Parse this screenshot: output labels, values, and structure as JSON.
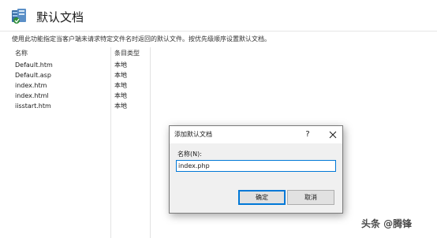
{
  "header": {
    "title": "默认文档",
    "icon": "iis-server-icon"
  },
  "description": "使用此功能指定当客户端未请求特定文件名时返回的默认文件。按优先级顺序设置默认文档。",
  "list": {
    "columns": [
      "名称",
      "条目类型"
    ],
    "rows": [
      {
        "name": "Default.htm",
        "type": "本地"
      },
      {
        "name": "Default.asp",
        "type": "本地"
      },
      {
        "name": "index.htm",
        "type": "本地"
      },
      {
        "name": "index.html",
        "type": "本地"
      },
      {
        "name": "iisstart.htm",
        "type": "本地"
      }
    ]
  },
  "dialog": {
    "title": "添加默认文档",
    "help": "?",
    "name_label": "名称(N):",
    "name_value": "index.php",
    "ok_label": "确定",
    "cancel_label": "取消"
  },
  "watermark": "头条 @腾锋",
  "colors": {
    "accent": "#0078d7",
    "dialog_bg": "#f0f0f0",
    "button_bg": "#e1e1e1"
  }
}
